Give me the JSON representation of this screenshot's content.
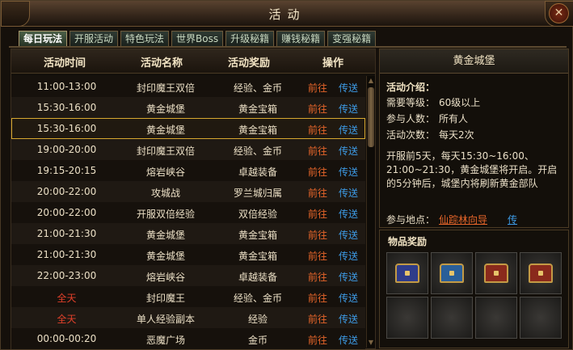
{
  "window": {
    "title": "活动",
    "close_icon": "close-icon"
  },
  "tabs": [
    {
      "label": "每日玩法",
      "active": true
    },
    {
      "label": "开服活动"
    },
    {
      "label": "特色玩法"
    },
    {
      "label": "世界Boss"
    },
    {
      "label": "升级秘籍"
    },
    {
      "label": "赚钱秘籍"
    },
    {
      "label": "变强秘籍"
    }
  ],
  "table": {
    "headers": {
      "time": "活动时间",
      "name": "活动名称",
      "reward": "活动奖励",
      "action": "操作"
    },
    "rows": [
      {
        "time": "11:00-13:00",
        "name": "封印魔王双倍",
        "reward": "经验、金币",
        "go": "前往",
        "tp": "传送"
      },
      {
        "time": "15:30-16:00",
        "name": "黄金城堡",
        "reward": "黄金宝箱",
        "go": "前往",
        "tp": "传送"
      },
      {
        "time": "15:30-16:00",
        "name": "黄金城堡",
        "reward": "黄金宝箱",
        "go": "前往",
        "tp": "传送",
        "selected": true
      },
      {
        "time": "19:00-20:00",
        "name": "封印魔王双倍",
        "reward": "经验、金币",
        "go": "前往",
        "tp": "传送"
      },
      {
        "time": "19:15-20:15",
        "name": "熔岩峡谷",
        "reward": "卓越装备",
        "go": "前往",
        "tp": "传送"
      },
      {
        "time": "20:00-22:00",
        "name": "攻城战",
        "reward": "罗兰城归属",
        "go": "前往",
        "tp": "传送"
      },
      {
        "time": "20:00-22:00",
        "name": "开服双倍经验",
        "reward": "双倍经验",
        "go": "前往",
        "tp": "传送"
      },
      {
        "time": "21:00-21:30",
        "name": "黄金城堡",
        "reward": "黄金宝箱",
        "go": "前往",
        "tp": "传送"
      },
      {
        "time": "21:00-21:30",
        "name": "黄金城堡",
        "reward": "黄金宝箱",
        "go": "前往",
        "tp": "传送"
      },
      {
        "time": "22:00-23:00",
        "name": "熔岩峡谷",
        "reward": "卓越装备",
        "go": "前往",
        "tp": "传送"
      },
      {
        "time": "全天",
        "name": "封印魔王",
        "reward": "经验、金币",
        "go": "前往",
        "tp": "传送",
        "time_red": true
      },
      {
        "time": "全天",
        "name": "单人经验副本",
        "reward": "经验",
        "go": "前往",
        "tp": "传送",
        "time_red": true
      },
      {
        "time": "00:00-00:20",
        "name": "恶魔广场",
        "reward": "金币",
        "go": "前往",
        "tp": "传送"
      }
    ]
  },
  "detail": {
    "title": "黄金城堡",
    "intro_label": "活动介绍：",
    "level_label": "需要等级：",
    "level_value": "60级以上",
    "people_label": "参与人数：",
    "people_value": "所有人",
    "count_label": "活动次数：",
    "count_value": "每天2次",
    "description": "开服前5天，每天15:30~16:00、21:00~21:30，黄金城堡将开启。开启的5分钟后，城堡内将刷新黄金部队",
    "location_label": "参与地点：",
    "location_value": "仙踪林向导",
    "location_tp": "传"
  },
  "rewards": {
    "title": "物品奖励",
    "slots": [
      {
        "icon": "chest-icon",
        "color": "#2f3c8a"
      },
      {
        "icon": "chest-icon",
        "color": "#2a5f99"
      },
      {
        "icon": "chest-icon",
        "color": "#8a2a1c"
      },
      {
        "icon": "chest-icon",
        "color": "#8a2a1c"
      },
      {
        "icon": "empty"
      },
      {
        "icon": "empty"
      },
      {
        "icon": "empty"
      },
      {
        "icon": "empty"
      }
    ]
  }
}
